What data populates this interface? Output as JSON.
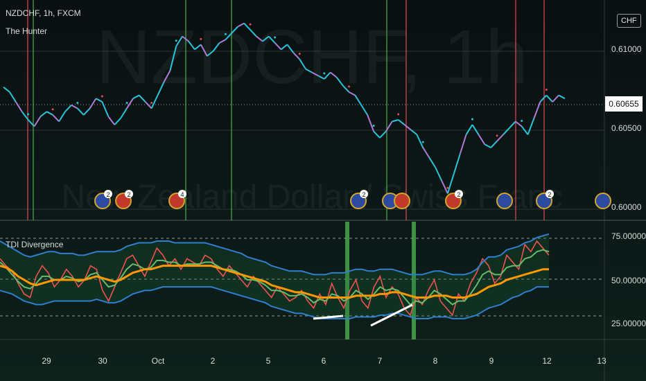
{
  "symbol_header": "NZDCHF, 1h, FXCM",
  "indicator_name": "The Hunter",
  "currency_badge": "CHF",
  "watermark": "NZDCHF, 1h",
  "watermark_sub": "New Zealand Dollar / Swiss Franc",
  "last_price": "0.60655",
  "colors": {
    "accent_red": "#e8475a",
    "accent_green": "#4caf50",
    "cyan": "#26c6da",
    "purple": "#b07bd8",
    "orange": "#ff9800",
    "blue_band": "#2f7fd1"
  },
  "price_axis": [
    "0.61000",
    "0.60500",
    "0.60000"
  ],
  "osc_axis": [
    "75.00000",
    "50.00000",
    "25.00000"
  ],
  "date_labels": [
    "29",
    "30",
    "Oct",
    "2",
    "5",
    "6",
    "7",
    "8",
    "9",
    "12",
    "13"
  ],
  "osc_title": "TDI Divergence",
  "event_badges": [
    {
      "count": "2"
    },
    {
      "count": "2"
    },
    {
      "count": "4"
    },
    {
      "count": "2"
    },
    {
      "count": "2"
    },
    {
      "count": "2"
    },
    {
      "count": ""
    }
  ],
  "chart_data": [
    {
      "type": "line",
      "title": "NZDCHF, 1h, FXCM",
      "series": [
        {
          "name": "The Hunter",
          "values": [
            0.6073,
            0.607,
            0.6064,
            0.6058,
            0.6053,
            0.6049,
            0.6055,
            0.6058,
            0.6056,
            0.6052,
            0.6058,
            0.6062,
            0.606,
            0.6056,
            0.606,
            0.6066,
            0.6064,
            0.6055,
            0.605,
            0.6054,
            0.606,
            0.6066,
            0.6068,
            0.6064,
            0.606,
            0.6068,
            0.6076,
            0.6083,
            0.6098,
            0.6104,
            0.6101,
            0.6096,
            0.6099,
            0.6092,
            0.6095,
            0.61,
            0.6102,
            0.6106,
            0.611,
            0.6112,
            0.6108,
            0.6104,
            0.6101,
            0.6104,
            0.61,
            0.6096,
            0.6099,
            0.6094,
            0.609,
            0.6084,
            0.6082,
            0.608,
            0.6078,
            0.6082,
            0.6079,
            0.6074,
            0.607,
            0.6068,
            0.6062,
            0.6056,
            0.6046,
            0.6042,
            0.6046,
            0.6052,
            0.6053,
            0.605,
            0.6047,
            0.6044,
            0.6036,
            0.603,
            0.6024,
            0.6016,
            0.6008,
            0.602,
            0.6032,
            0.6044,
            0.605,
            0.6044,
            0.6038,
            0.6036,
            0.604,
            0.6044,
            0.6048,
            0.6052,
            0.6049,
            0.6044,
            0.6054,
            0.6064,
            0.6068,
            0.6064,
            0.6068,
            0.6066
          ]
        }
      ],
      "ylim": [
        0.5995,
        0.6122
      ]
    },
    {
      "type": "line",
      "title": "TDI Divergence",
      "series": [
        {
          "name": "rsi",
          "values": [
            62,
            58,
            55,
            48,
            42,
            40,
            52,
            58,
            54,
            46,
            50,
            56,
            52,
            46,
            50,
            58,
            56,
            44,
            38,
            46,
            54,
            62,
            64,
            58,
            52,
            60,
            68,
            64,
            58,
            62,
            56,
            62,
            60,
            58,
            64,
            62,
            56,
            52,
            58,
            54,
            50,
            46,
            52,
            48,
            44,
            40,
            46,
            42,
            38,
            40,
            44,
            38,
            34,
            42,
            36,
            48,
            40,
            34,
            44,
            50,
            38,
            34,
            46,
            52,
            40,
            46,
            42,
            34,
            30,
            40,
            36,
            44,
            50,
            38,
            34,
            30,
            42,
            38,
            48,
            54,
            62,
            58,
            48,
            52,
            64,
            60,
            56,
            70,
            66,
            72,
            68,
            64
          ]
        },
        {
          "name": "signal",
          "values": [
            60,
            57,
            53,
            49,
            46,
            45,
            48,
            52,
            52,
            50,
            50,
            52,
            51,
            49,
            50,
            53,
            54,
            50,
            46,
            47,
            51,
            56,
            59,
            58,
            56,
            57,
            61,
            61,
            60,
            60,
            58,
            59,
            59,
            59,
            60,
            60,
            58,
            56,
            56,
            55,
            53,
            50,
            50,
            49,
            47,
            44,
            44,
            43,
            41,
            41,
            42,
            40,
            37,
            39,
            38,
            42,
            41,
            38,
            40,
            44,
            42,
            39,
            42,
            46,
            44,
            45,
            44,
            40,
            36,
            38,
            37,
            40,
            44,
            42,
            39,
            36,
            38,
            38,
            42,
            47,
            53,
            55,
            53,
            53,
            57,
            58,
            58,
            62,
            63,
            66,
            67,
            66
          ]
        },
        {
          "name": "base",
          "values": [
            58,
            57,
            55,
            52,
            50,
            48,
            47,
            48,
            49,
            50,
            50,
            50,
            50,
            50,
            50,
            51,
            52,
            51,
            50,
            49,
            50,
            52,
            54,
            55,
            56,
            56,
            57,
            58,
            58,
            58,
            58,
            58,
            58,
            58,
            58,
            58,
            57,
            56,
            55,
            54,
            53,
            52,
            51,
            50,
            49,
            47,
            46,
            45,
            44,
            43,
            43,
            42,
            41,
            40,
            40,
            40,
            40,
            40,
            40,
            41,
            41,
            41,
            41,
            42,
            42,
            43,
            43,
            42,
            41,
            40,
            40,
            40,
            41,
            41,
            41,
            40,
            40,
            40,
            41,
            42,
            44,
            46,
            47,
            48,
            50,
            51,
            52,
            53,
            54,
            55,
            56,
            56
          ]
        },
        {
          "name": "upper",
          "values": [
            72,
            70,
            68,
            66,
            64,
            63,
            64,
            65,
            66,
            66,
            65,
            65,
            65,
            64,
            64,
            65,
            66,
            66,
            66,
            66,
            67,
            69,
            70,
            71,
            71,
            71,
            72,
            72,
            72,
            71,
            71,
            71,
            71,
            71,
            71,
            70,
            69,
            68,
            67,
            66,
            65,
            63,
            62,
            61,
            60,
            58,
            57,
            56,
            55,
            55,
            55,
            54,
            53,
            53,
            53,
            54,
            54,
            54,
            55,
            56,
            56,
            55,
            55,
            56,
            56,
            56,
            55,
            54,
            53,
            53,
            53,
            54,
            55,
            55,
            54,
            53,
            53,
            53,
            54,
            56,
            60,
            63,
            63,
            64,
            67,
            68,
            69,
            71,
            72,
            74,
            75,
            76
          ]
        },
        {
          "name": "lower",
          "values": [
            44,
            43,
            42,
            40,
            38,
            37,
            36,
            36,
            37,
            38,
            38,
            38,
            38,
            38,
            38,
            38,
            39,
            38,
            37,
            37,
            38,
            40,
            42,
            43,
            44,
            44,
            45,
            46,
            46,
            46,
            46,
            46,
            46,
            46,
            46,
            46,
            45,
            44,
            43,
            42,
            41,
            40,
            39,
            38,
            37,
            35,
            34,
            33,
            32,
            31,
            31,
            30,
            29,
            28,
            28,
            28,
            28,
            28,
            28,
            29,
            29,
            29,
            29,
            30,
            30,
            31,
            31,
            30,
            29,
            28,
            28,
            28,
            29,
            29,
            29,
            28,
            28,
            28,
            29,
            30,
            32,
            34,
            35,
            36,
            38,
            40,
            41,
            43,
            44,
            46,
            46,
            46
          ]
        }
      ],
      "ylim": [
        17,
        83
      ]
    }
  ]
}
